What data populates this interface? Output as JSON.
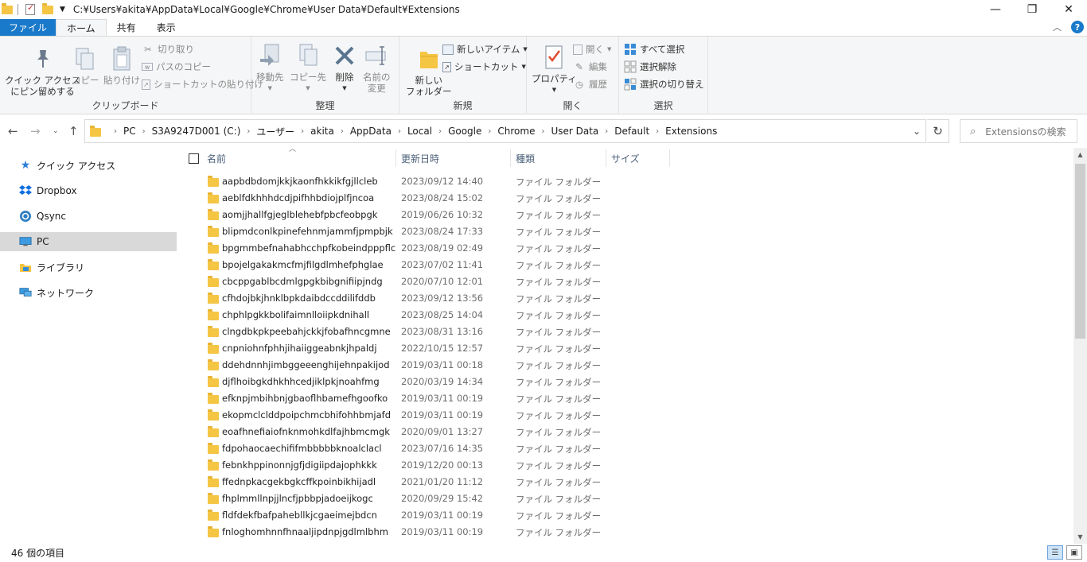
{
  "window": {
    "title_path": "C:¥Users¥akita¥AppData¥Local¥Google¥Chrome¥User Data¥Default¥Extensions",
    "controls": {
      "minimize": "—",
      "maximize": "❐",
      "close": "✕"
    }
  },
  "tabs": [
    {
      "label": "ファイル"
    },
    {
      "label": "ホーム"
    },
    {
      "label": "共有"
    },
    {
      "label": "表示"
    }
  ],
  "ribbon": {
    "clipboard": {
      "label": "クリップボード",
      "pin": "クイック アクセス\nにピン留めする",
      "copy": "コピー",
      "paste": "貼り付け",
      "cut": "切り取り",
      "copy_path": "パスのコピー",
      "paste_shortcut": "ショートカットの貼り付け"
    },
    "organize": {
      "label": "整理",
      "move_to": "移動先",
      "copy_to": "コピー先",
      "delete": "削除",
      "rename": "名前の\n変更"
    },
    "new": {
      "label": "新規",
      "new_folder": "新しい\nフォルダー",
      "new_item": "新しいアイテム",
      "shortcut": "ショートカット"
    },
    "open": {
      "label": "開く",
      "properties": "プロパティ",
      "open": "開く",
      "edit": "編集",
      "history": "履歴"
    },
    "select": {
      "label": "選択",
      "select_all": "すべて選択",
      "select_none": "選択解除",
      "invert": "選択の切り替え"
    }
  },
  "address": {
    "crumbs": [
      "PC",
      "S3A9247D001 (C:)",
      "ユーザー",
      "akita",
      "AppData",
      "Local",
      "Google",
      "Chrome",
      "User Data",
      "Default",
      "Extensions"
    ],
    "search_placeholder": "Extensionsの検索"
  },
  "sidebar": {
    "items": [
      {
        "label": "クイック アクセス",
        "icon": "star-icon"
      },
      {
        "label": "Dropbox",
        "icon": "dropbox-icon"
      },
      {
        "label": "Qsync",
        "icon": "qsync-icon"
      },
      {
        "label": "PC",
        "icon": "pc-icon"
      },
      {
        "label": "ライブラリ",
        "icon": "library-icon"
      },
      {
        "label": "ネットワーク",
        "icon": "network-icon"
      }
    ]
  },
  "columns": {
    "name": "名前",
    "date": "更新日時",
    "type": "種類",
    "size": "サイズ"
  },
  "files": [
    {
      "name": "aapbdbdomjkkjkaonfhkkikfgjllcleb",
      "date": "2023/09/12 14:40",
      "type": "ファイル フォルダー"
    },
    {
      "name": "aeblfdkhhhdcdjpifhhbdiojplfjncoa",
      "date": "2023/08/24 15:02",
      "type": "ファイル フォルダー"
    },
    {
      "name": "aomjjhallfgjeglblehebfpbcfeobpgk",
      "date": "2019/06/26 10:32",
      "type": "ファイル フォルダー"
    },
    {
      "name": "blipmdconlkpinefehnmjammfjpmpbjk",
      "date": "2023/08/24 17:33",
      "type": "ファイル フォルダー"
    },
    {
      "name": "bpgmmbefnahabhcchpfkobeindpppflc",
      "date": "2023/08/19 02:49",
      "type": "ファイル フォルダー"
    },
    {
      "name": "bpojelgakakmcfmjfilgdlmhefphglae",
      "date": "2023/07/02 11:41",
      "type": "ファイル フォルダー"
    },
    {
      "name": "cbcppgablbcdmlgpgkbibgnifiipjndg",
      "date": "2020/07/10 12:01",
      "type": "ファイル フォルダー"
    },
    {
      "name": "cfhdojbkjhnklbpkdaibdccddilifddb",
      "date": "2023/09/12 13:56",
      "type": "ファイル フォルダー"
    },
    {
      "name": "chphlpgkkbolifaimnlloiipkdnihall",
      "date": "2023/08/25 14:04",
      "type": "ファイル フォルダー"
    },
    {
      "name": "clngdbkpkpeebahjckkjfobafhncgmne",
      "date": "2023/08/31 13:16",
      "type": "ファイル フォルダー"
    },
    {
      "name": "cnpniohnfphhjihaiiggeabnkjhpaldj",
      "date": "2022/10/15 12:57",
      "type": "ファイル フォルダー"
    },
    {
      "name": "ddehdnnhjimbggeeenghijehnpakijod",
      "date": "2019/03/11 00:18",
      "type": "ファイル フォルダー"
    },
    {
      "name": "djflhoibgkdhkhhcedjiklpkjnoahfmg",
      "date": "2020/03/19 14:34",
      "type": "ファイル フォルダー"
    },
    {
      "name": "efknpjmbihbnjgbaoflhbamefhgoofko",
      "date": "2019/03/11 00:19",
      "type": "ファイル フォルダー"
    },
    {
      "name": "ekopmclclddpoipchmcbhifohhbmjafd",
      "date": "2019/03/11 00:19",
      "type": "ファイル フォルダー"
    },
    {
      "name": "eoafhnefiaiofnknmohkdlfajhbmcmgk",
      "date": "2020/09/01 13:27",
      "type": "ファイル フォルダー"
    },
    {
      "name": "fdpohaocaechififmbbbbbknoalclacl",
      "date": "2023/07/16 14:35",
      "type": "ファイル フォルダー"
    },
    {
      "name": "febnkhppinonnjgfjdigiipdajophkkk",
      "date": "2019/12/20 00:13",
      "type": "ファイル フォルダー"
    },
    {
      "name": "ffednpkacgekbgkcffkpoinbikhijadl",
      "date": "2021/01/20 11:12",
      "type": "ファイル フォルダー"
    },
    {
      "name": "fhplmmllnpjjlncfjpbbpjadoeijkogc",
      "date": "2020/09/29 15:42",
      "type": "ファイル フォルダー"
    },
    {
      "name": "fldfdekfbafpahebllkjcgaeimejbdcn",
      "date": "2019/03/11 00:19",
      "type": "ファイル フォルダー"
    },
    {
      "name": "fnloghomhnnfhnaaljipdnpjgdlmlbhm",
      "date": "2019/03/11 00:19",
      "type": "ファイル フォルダー"
    }
  ],
  "status": {
    "item_count": "46 個の項目"
  }
}
